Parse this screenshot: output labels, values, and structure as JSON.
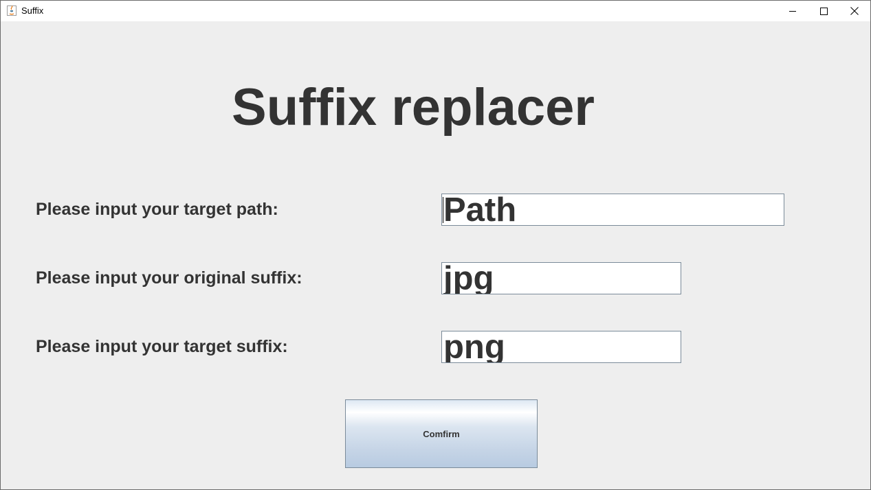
{
  "window": {
    "title": "Suffix",
    "icon": "java-icon"
  },
  "controls": {
    "minimize": "minimize-icon",
    "maximize": "maximize-icon",
    "close": "close-icon"
  },
  "heading": "Suffix replacer",
  "form": {
    "path_label": "Please input your target path:",
    "path_value": "Path",
    "original_label": "Please input your original suffix:",
    "original_value": "jpg",
    "target_label": "Please input your target suffix:",
    "target_value": "png"
  },
  "confirm_label": "Comfirm"
}
